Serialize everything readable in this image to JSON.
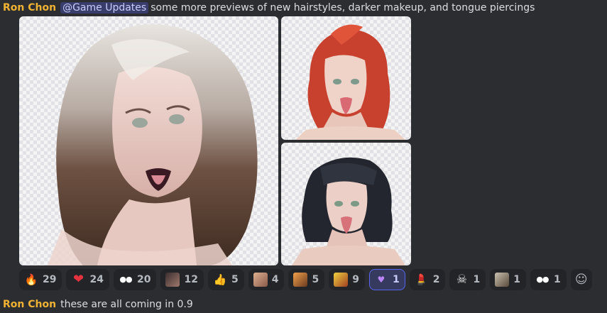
{
  "message1": {
    "author": "Ron Chon",
    "mention": "@Game Updates",
    "text": "some more previews of new hairstyles, darker makeup, and tongue piercings"
  },
  "attachments": [
    {
      "name": "white-brown-hair-preview"
    },
    {
      "name": "red-hair-preview"
    },
    {
      "name": "black-hair-preview"
    }
  ],
  "reactions": [
    {
      "emoji": "🔥",
      "icon": "fire-icon",
      "count": "29"
    },
    {
      "emoji": "❤",
      "icon": "red-heart-icon",
      "count": "24"
    },
    {
      "emoji": "●●",
      "icon": "eyes-icon",
      "count": "20"
    },
    {
      "emoji": "",
      "icon": "custom-emoji-portrait-icon",
      "count": "12"
    },
    {
      "emoji": "👍",
      "icon": "thumbs-up-icon",
      "count": "5"
    },
    {
      "emoji": "",
      "icon": "custom-emoji-face-icon",
      "count": "4"
    },
    {
      "emoji": "",
      "icon": "custom-emoji-character-icon",
      "count": "5"
    },
    {
      "emoji": "",
      "icon": "custom-emoji-screaming-icon",
      "count": "9"
    },
    {
      "emoji": "♥",
      "icon": "purple-hearts-icon",
      "count": "1",
      "active": true
    },
    {
      "emoji": "💄",
      "icon": "lipstick-icon",
      "count": "2"
    },
    {
      "emoji": "☠",
      "icon": "skull-icon",
      "count": "1"
    },
    {
      "emoji": "",
      "icon": "custom-emoji-blonde-icon",
      "count": "1"
    },
    {
      "emoji": "●●",
      "icon": "eyes-icon",
      "count": "1"
    }
  ],
  "add_reaction_icon": "☺",
  "message2": {
    "author": "Ron Chon",
    "text": "these are all coming in 0.9"
  },
  "colors": {
    "background": "#2b2d31",
    "author": "#f0b232",
    "mention_bg": "#3c4270",
    "active_reaction_border": "#5865f2"
  }
}
